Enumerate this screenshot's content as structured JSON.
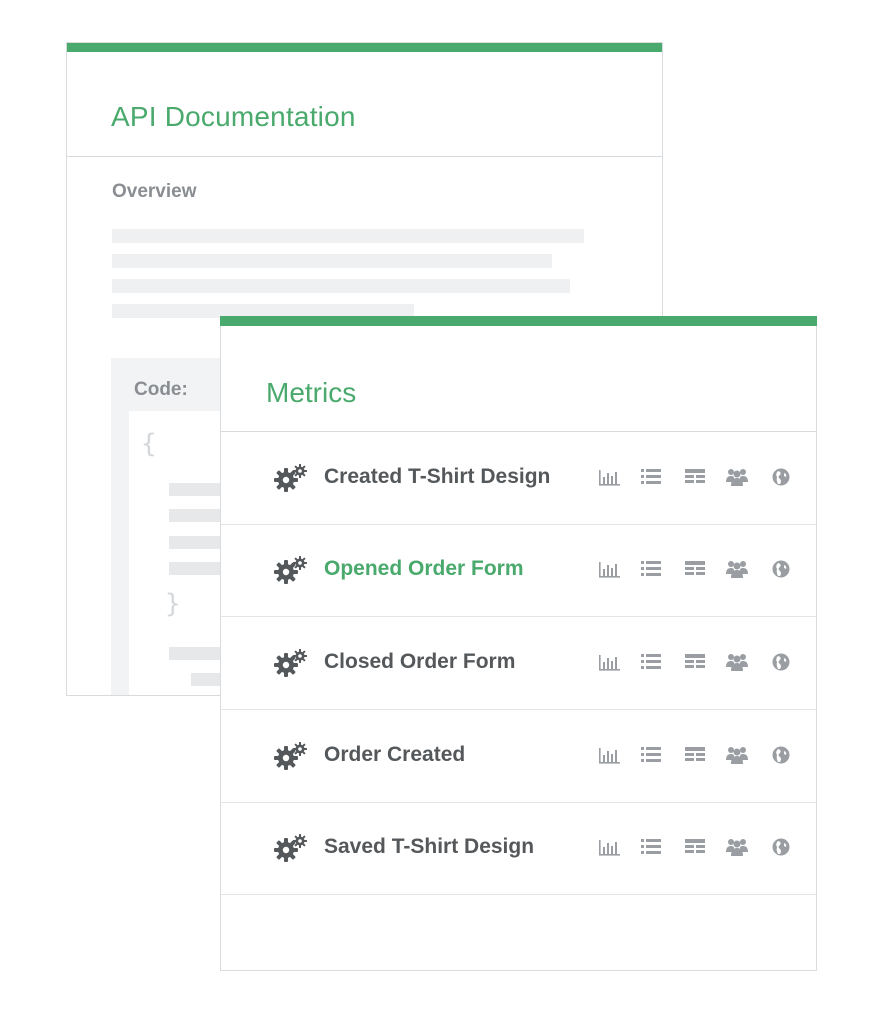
{
  "api_doc": {
    "title": "API Documentation",
    "overview_label": "Overview",
    "code_label": "Code:",
    "open_brace": "{",
    "close_brace": "}"
  },
  "metrics": {
    "title": "Metrics",
    "rows": [
      {
        "label": "Created T-Shirt Design",
        "active": false
      },
      {
        "label": "Opened Order Form",
        "active": true
      },
      {
        "label": "Closed Order Form",
        "active": false
      },
      {
        "label": "Order Created",
        "active": false
      },
      {
        "label": "Saved T-Shirt Design",
        "active": false
      }
    ],
    "row_icons": [
      "gears-icon",
      "bar-chart-icon",
      "list-icon",
      "table-icon",
      "users-icon",
      "globe-icon"
    ]
  },
  "colors": {
    "accent": "#4aa96c",
    "text": "#55585b",
    "muted": "#8a8e92",
    "icon": "#9a9ea2"
  }
}
